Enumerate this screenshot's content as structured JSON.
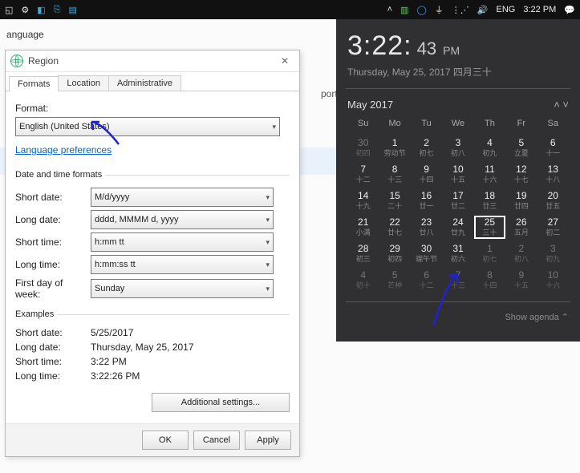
{
  "taskbar": {
    "lang": "ENG",
    "clock": "3:22 PM"
  },
  "behind": {
    "crumb": "anguage",
    "partial": "port."
  },
  "dialog": {
    "title": "Region",
    "tabs": [
      "Formats",
      "Location",
      "Administrative"
    ],
    "format_label": "Format:",
    "format_value": "English (United States)",
    "lang_pref_link": "Language preferences",
    "dtf_legend": "Date and time formats",
    "fields": {
      "short_date_k": "Short date:",
      "short_date_v": "M/d/yyyy",
      "long_date_k": "Long date:",
      "long_date_v": "dddd, MMMM d, yyyy",
      "short_time_k": "Short time:",
      "short_time_v": "h:mm tt",
      "long_time_k": "Long time:",
      "long_time_v": "h:mm:ss tt",
      "fdow_k": "First day of week:",
      "fdow_v": "Sunday"
    },
    "ex_legend": "Examples",
    "examples": {
      "short_date_k": "Short date:",
      "short_date_v": "5/25/2017",
      "long_date_k": "Long date:",
      "long_date_v": "Thursday, May 25, 2017",
      "short_time_k": "Short time:",
      "short_time_v": "3:22 PM",
      "long_time_k": "Long time:",
      "long_time_v": "3:22:26 PM"
    },
    "additional": "Additional settings...",
    "ok": "OK",
    "cancel": "Cancel",
    "apply": "Apply"
  },
  "flyout": {
    "hm": "3:22:",
    "sec": "43",
    "ampm": "PM",
    "date": "Thursday, May 25, 2017 四月三十",
    "month": "May 2017",
    "dow": [
      "Su",
      "Mo",
      "Tu",
      "We",
      "Th",
      "Fr",
      "Sa"
    ],
    "agenda": "Show agenda ⌃",
    "cells": [
      {
        "n": "30",
        "a": "初四",
        "dim": true
      },
      {
        "n": "1",
        "a": "劳动节"
      },
      {
        "n": "2",
        "a": "初七"
      },
      {
        "n": "3",
        "a": "初八"
      },
      {
        "n": "4",
        "a": "初九"
      },
      {
        "n": "5",
        "a": "立夏"
      },
      {
        "n": "6",
        "a": "十一"
      },
      {
        "n": "7",
        "a": "十二"
      },
      {
        "n": "8",
        "a": "十三"
      },
      {
        "n": "9",
        "a": "十四"
      },
      {
        "n": "10",
        "a": "十五"
      },
      {
        "n": "11",
        "a": "十六"
      },
      {
        "n": "12",
        "a": "十七"
      },
      {
        "n": "13",
        "a": "十八"
      },
      {
        "n": "14",
        "a": "十九"
      },
      {
        "n": "15",
        "a": "二十"
      },
      {
        "n": "16",
        "a": "廿一"
      },
      {
        "n": "17",
        "a": "廿二"
      },
      {
        "n": "18",
        "a": "廿三"
      },
      {
        "n": "19",
        "a": "廿四"
      },
      {
        "n": "20",
        "a": "廿五"
      },
      {
        "n": "21",
        "a": "小满"
      },
      {
        "n": "22",
        "a": "廿七"
      },
      {
        "n": "23",
        "a": "廿八"
      },
      {
        "n": "24",
        "a": "廿九"
      },
      {
        "n": "25",
        "a": "三十",
        "today": true
      },
      {
        "n": "26",
        "a": "五月"
      },
      {
        "n": "27",
        "a": "初二"
      },
      {
        "n": "28",
        "a": "初三"
      },
      {
        "n": "29",
        "a": "初四"
      },
      {
        "n": "30",
        "a": "端午节"
      },
      {
        "n": "31",
        "a": "初六"
      },
      {
        "n": "1",
        "a": "初七",
        "dim": true
      },
      {
        "n": "2",
        "a": "初八",
        "dim": true
      },
      {
        "n": "3",
        "a": "初九",
        "dim": true
      },
      {
        "n": "4",
        "a": "初十",
        "dim": true
      },
      {
        "n": "5",
        "a": "芒种",
        "dim": true
      },
      {
        "n": "6",
        "a": "十二",
        "dim": true
      },
      {
        "n": "7",
        "a": "十三",
        "dim": true
      },
      {
        "n": "8",
        "a": "十四",
        "dim": true
      },
      {
        "n": "9",
        "a": "十五",
        "dim": true
      },
      {
        "n": "10",
        "a": "十六",
        "dim": true
      }
    ]
  }
}
